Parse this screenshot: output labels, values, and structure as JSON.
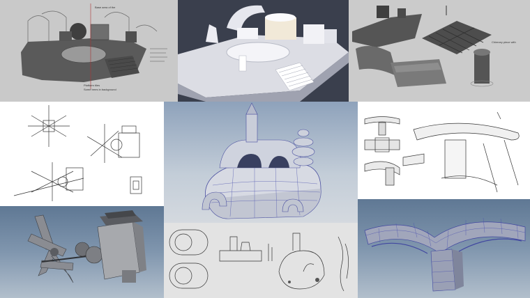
{
  "sheet": {
    "tiles": [
      {
        "id": "t1",
        "subject": "sketched courtyard with bridge",
        "style": "pencil sketch on grey"
      },
      {
        "id": "t2",
        "subject": "white blockout model of courtyard with stairs",
        "style": "clay render on dark"
      },
      {
        "id": "t3",
        "subject": "grey modular pieces: floor, arch, tower",
        "style": "grey render"
      },
      {
        "id": "t4",
        "subject": "windmill concept sketches",
        "style": "line sketch"
      },
      {
        "id": "t5",
        "subject": "fortress on hill model with wireframe",
        "style": "wireframe on gradient"
      },
      {
        "id": "t6",
        "subject": "bridge concept sketches",
        "style": "line sketch"
      },
      {
        "id": "t7",
        "subject": "windmill 3D model",
        "style": "grey render on blue"
      },
      {
        "id": "t8",
        "subject": "orthographic sketches of fortress",
        "style": "line sketch on grey"
      },
      {
        "id": "t9",
        "subject": "stone arch bridge wireframe",
        "style": "wireframe on gradient"
      }
    ]
  },
  "annotations": {
    "t1_note_a": "Base area of the",
    "t1_note_b": "Platform tiles",
    "t1_note_c": "Some trees in background",
    "t3_note": "Chimney piece with"
  }
}
